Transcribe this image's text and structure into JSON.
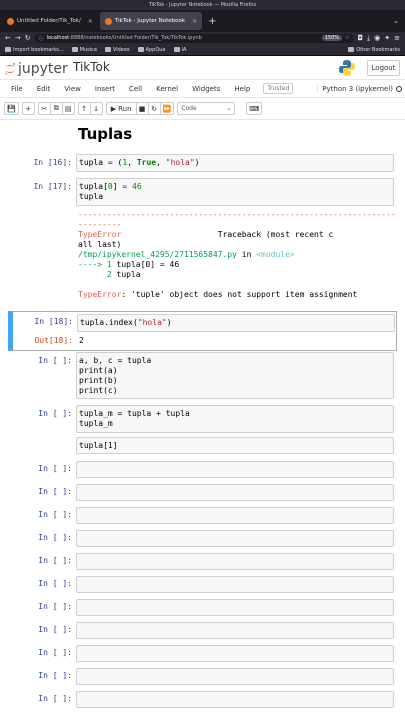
{
  "browser": {
    "window_title": "TikTok - Jupyter Notebook — Mozilla Firefox",
    "tabs": [
      {
        "label": "Untitled Folder/Tik_Tok/"
      },
      {
        "label": "TikTok - Jupyter Notebook"
      }
    ],
    "url_host": "localhost",
    "url_path": ":8888/notebooks/Untitled Folder/Tik_Tok/TikTok.ipynb",
    "zoom": "150%",
    "bookmarks": [
      "Import bookmarks...",
      "Musica",
      "Videos",
      "AppQua",
      "IA"
    ],
    "other_bookmarks": "Other Bookmarks"
  },
  "jupyter": {
    "logo_text": "jupyter",
    "notebook_name": "TikTok",
    "logout_label": "Logout",
    "menu": [
      "File",
      "Edit",
      "View",
      "Insert",
      "Cell",
      "Kernel",
      "Widgets",
      "Help"
    ],
    "trusted": "Trusted",
    "kernel": "Python 3 (ipykernel)",
    "toolbar": {
      "run_label": "Run",
      "celltype_value": "Code"
    }
  },
  "notebook": {
    "heading": "Tuplas",
    "prompts": {
      "c16": "In [16]:",
      "c17": "In [17]:",
      "c18": "In [18]:",
      "o18": "Out[18]:",
      "empty": "In [ ]:"
    },
    "traceback": {
      "dashes": "-----------------------------------------------------------------------------",
      "dashes2": "---------",
      "error_name": "TypeError",
      "traceback_label": "Traceback (most recent c",
      "all_last": "all last)",
      "file": "/tmp/ipykernel_4295/2711565847.py",
      "in_word": " in ",
      "module": "<module>",
      "arrow": "----> 1 ",
      "line1": "tupla[0] = 46",
      "lineno2": "      2 ",
      "line2": "tupla",
      "final_error_name": "TypeError",
      "final_error_msg": ": 'tuple' object does not support item assignment"
    },
    "out18_value": "2",
    "cell_c4_lines": [
      "a, b, c = tupla",
      "print(a)",
      "print(b)",
      "print(c)"
    ],
    "cell_c5_lines": [
      "tupla_m = tupla + tupla",
      "tupla_m"
    ],
    "cell_c6_line": "tupla[1]"
  }
}
